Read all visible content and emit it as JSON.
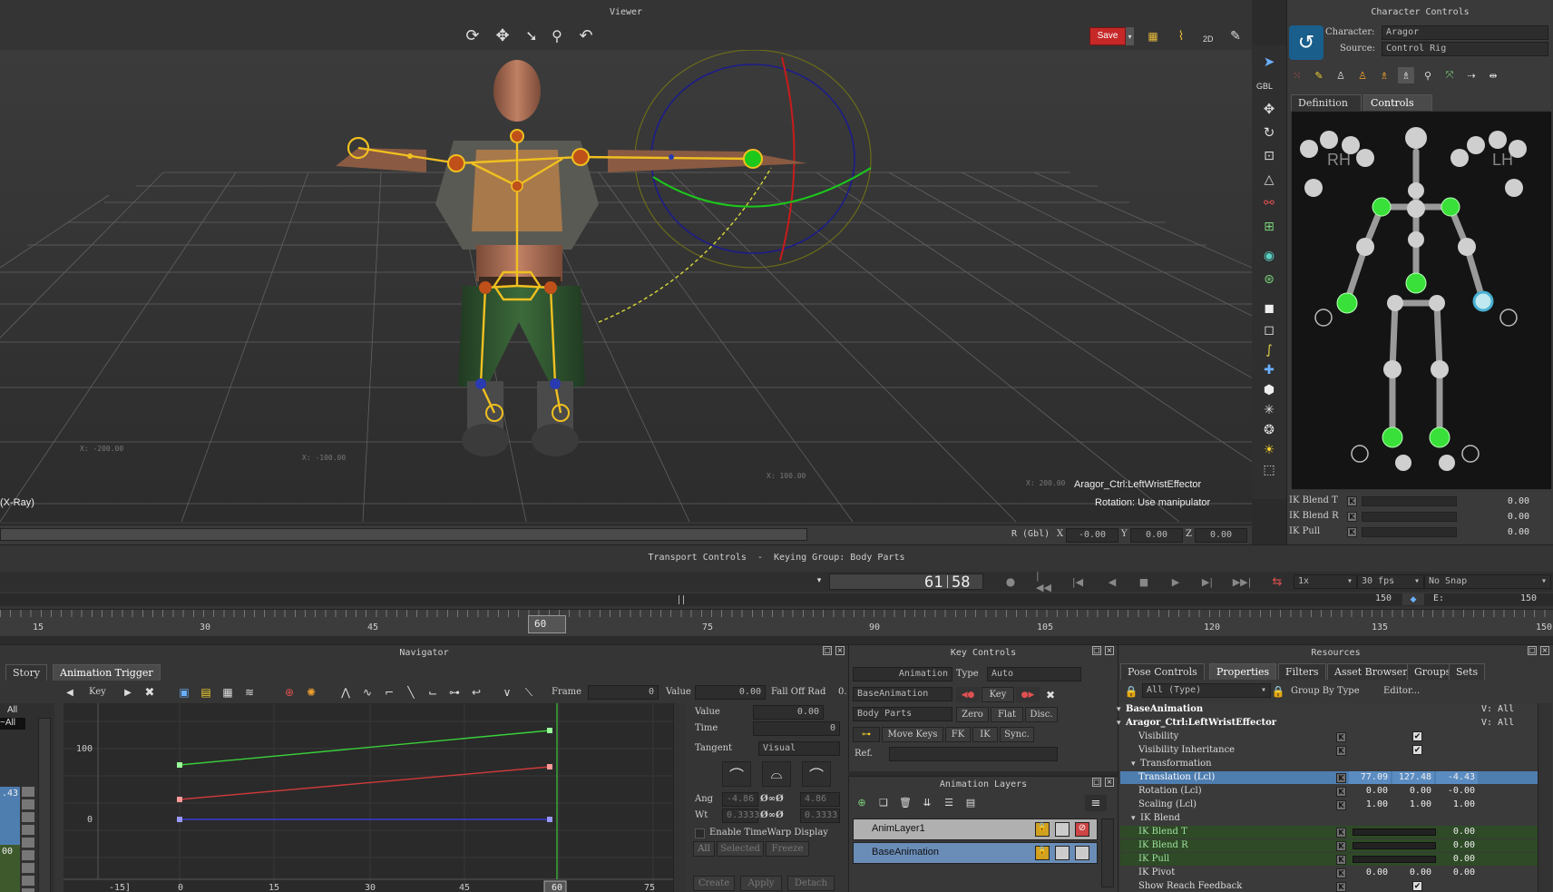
{
  "viewer": {
    "title": "Viewer",
    "save_label": "Save",
    "mode_label": "(X-Ray)",
    "selected_object": "Aragor_Ctrl:LeftWristEffector",
    "status_hint": "Rotation: Use manipulator",
    "gbl_label": "GBL",
    "twod_label": "2D",
    "rotation_readout": {
      "label": "R (Gbl)",
      "x_label": "X",
      "x": "-0.00",
      "y_label": "Y",
      "y": "0.00",
      "z_label": "Z",
      "z": "0.00"
    },
    "floor_labels": [
      "X: -200.00",
      "X: -100.00",
      "X: 100.00",
      "X: 200.00"
    ]
  },
  "character_controls": {
    "title": "Character Controls",
    "character_label": "Character:",
    "character_value": "Aragor",
    "source_label": "Source:",
    "source_value": "Control Rig",
    "tabs": [
      "Definition",
      "Controls"
    ],
    "active_tab": "Controls",
    "rh_label": "RH",
    "lh_label": "LH",
    "ik_rows": [
      {
        "label": "IK Blend T",
        "k": "K",
        "value": "0.00"
      },
      {
        "label": "IK Blend R",
        "k": "K",
        "value": "0.00"
      },
      {
        "label": "IK Pull",
        "k": "K",
        "value": "0.00"
      }
    ]
  },
  "transport": {
    "title": "Transport Controls  -  Keying Group: Body Parts",
    "frame_current": "61",
    "frame_end": "58",
    "speed": "1x",
    "fps": "30 fps",
    "snap": "No Snap",
    "end_frame": "150",
    "e_label": "E:",
    "e_value": "150",
    "ruler_ticks": [
      "15",
      "30",
      "45",
      "60",
      "75",
      "90",
      "105",
      "120",
      "135",
      "150"
    ],
    "playhead": "60"
  },
  "navigator": {
    "title": "Navigator",
    "tabs": [
      "Story",
      "Animation Trigger"
    ],
    "active_tab": "Animation Trigger",
    "key_label": "Key",
    "frame_label": "Frame",
    "frame_value": "0",
    "value_label": "Value",
    "value_value": "0.00",
    "falloff_label": "Fall Off Rad",
    "falloff_value": "0.",
    "left_list": [
      "All",
      "~All"
    ],
    "left_values": [
      ".43",
      "00"
    ],
    "y_ticks": [
      "100",
      "0"
    ],
    "x_ticks": [
      "-15]",
      "0",
      "15",
      "30",
      "45",
      "60",
      "75"
    ],
    "side": {
      "value_label": "Value",
      "value": "0.00",
      "time_label": "Time",
      "time": "0",
      "tangent_label": "Tangent",
      "tangent_value": "Visual",
      "ang_label": "Ang",
      "ang_left": "-4.86",
      "ang_right": "4.86",
      "wt_label": "Wt",
      "wt_left": "0.3333",
      "wt_right": "0.3333",
      "timewarp_label": "Enable TimeWarp Display",
      "filter_buttons": [
        "All",
        "Selected",
        "Freeze"
      ],
      "action_buttons": [
        "Create",
        "Apply",
        "Detach"
      ]
    }
  },
  "key_controls": {
    "title": "Key Controls",
    "animation_label": "Animation",
    "type_label": "Type",
    "type_value": "Auto",
    "take_value": "BaseAnimation",
    "key_label": "Key",
    "group_value": "Body Parts",
    "buttons_row1": [
      "Zero",
      "Flat",
      "Disc."
    ],
    "move_keys_label": "Move Keys",
    "buttons_row2": [
      "FK",
      "IK",
      "Sync."
    ],
    "ref_label": "Ref."
  },
  "anim_layers": {
    "title": "Animation Layers",
    "layers": [
      {
        "name": "AnimLayer1",
        "selected": false
      },
      {
        "name": "BaseAnimation",
        "selected": true
      }
    ]
  },
  "resources": {
    "title": "Resources",
    "tabs": [
      "Pose Controls",
      "Properties",
      "Filters",
      "Asset Browser",
      "Groups",
      "Sets"
    ],
    "active_tab": "Properties",
    "filter_value": "All (Type)",
    "group_by_label": "Group By Type",
    "editor_label": "Editor...",
    "rows": [
      {
        "label": "BaseAnimation",
        "right": "V: All",
        "kind": "header"
      },
      {
        "label": "Aragor_Ctrl:LeftWristEffector",
        "right": "V: All",
        "kind": "header"
      },
      {
        "label": "Visibility",
        "kind": "check"
      },
      {
        "label": "Visibility Inheritance",
        "kind": "check"
      },
      {
        "label": "Transformation",
        "kind": "group"
      },
      {
        "label": "Translation (Lcl)",
        "kind": "vec",
        "v1": "77.09",
        "v2": "127.48",
        "v3": "-4.43",
        "selected": true
      },
      {
        "label": "Rotation (Lcl)",
        "kind": "vec",
        "v1": "0.00",
        "v2": "0.00",
        "v3": "-0.00"
      },
      {
        "label": "Scaling (Lcl)",
        "kind": "vec",
        "v1": "1.00",
        "v2": "1.00",
        "v3": "1.00"
      },
      {
        "label": "IK Blend",
        "kind": "group"
      },
      {
        "label": "IK Blend T",
        "kind": "slider",
        "v": "0.00",
        "green": true
      },
      {
        "label": "IK Blend R",
        "kind": "slider",
        "v": "0.00",
        "green": true
      },
      {
        "label": "IK Pull",
        "kind": "slider",
        "v": "0.00",
        "green": true
      },
      {
        "label": "IK Pivot",
        "kind": "vec",
        "v1": "0.00",
        "v2": "0.00",
        "v3": "0.00"
      },
      {
        "label": "Show Reach Feedback",
        "kind": "check"
      }
    ],
    "k_label": "K"
  }
}
